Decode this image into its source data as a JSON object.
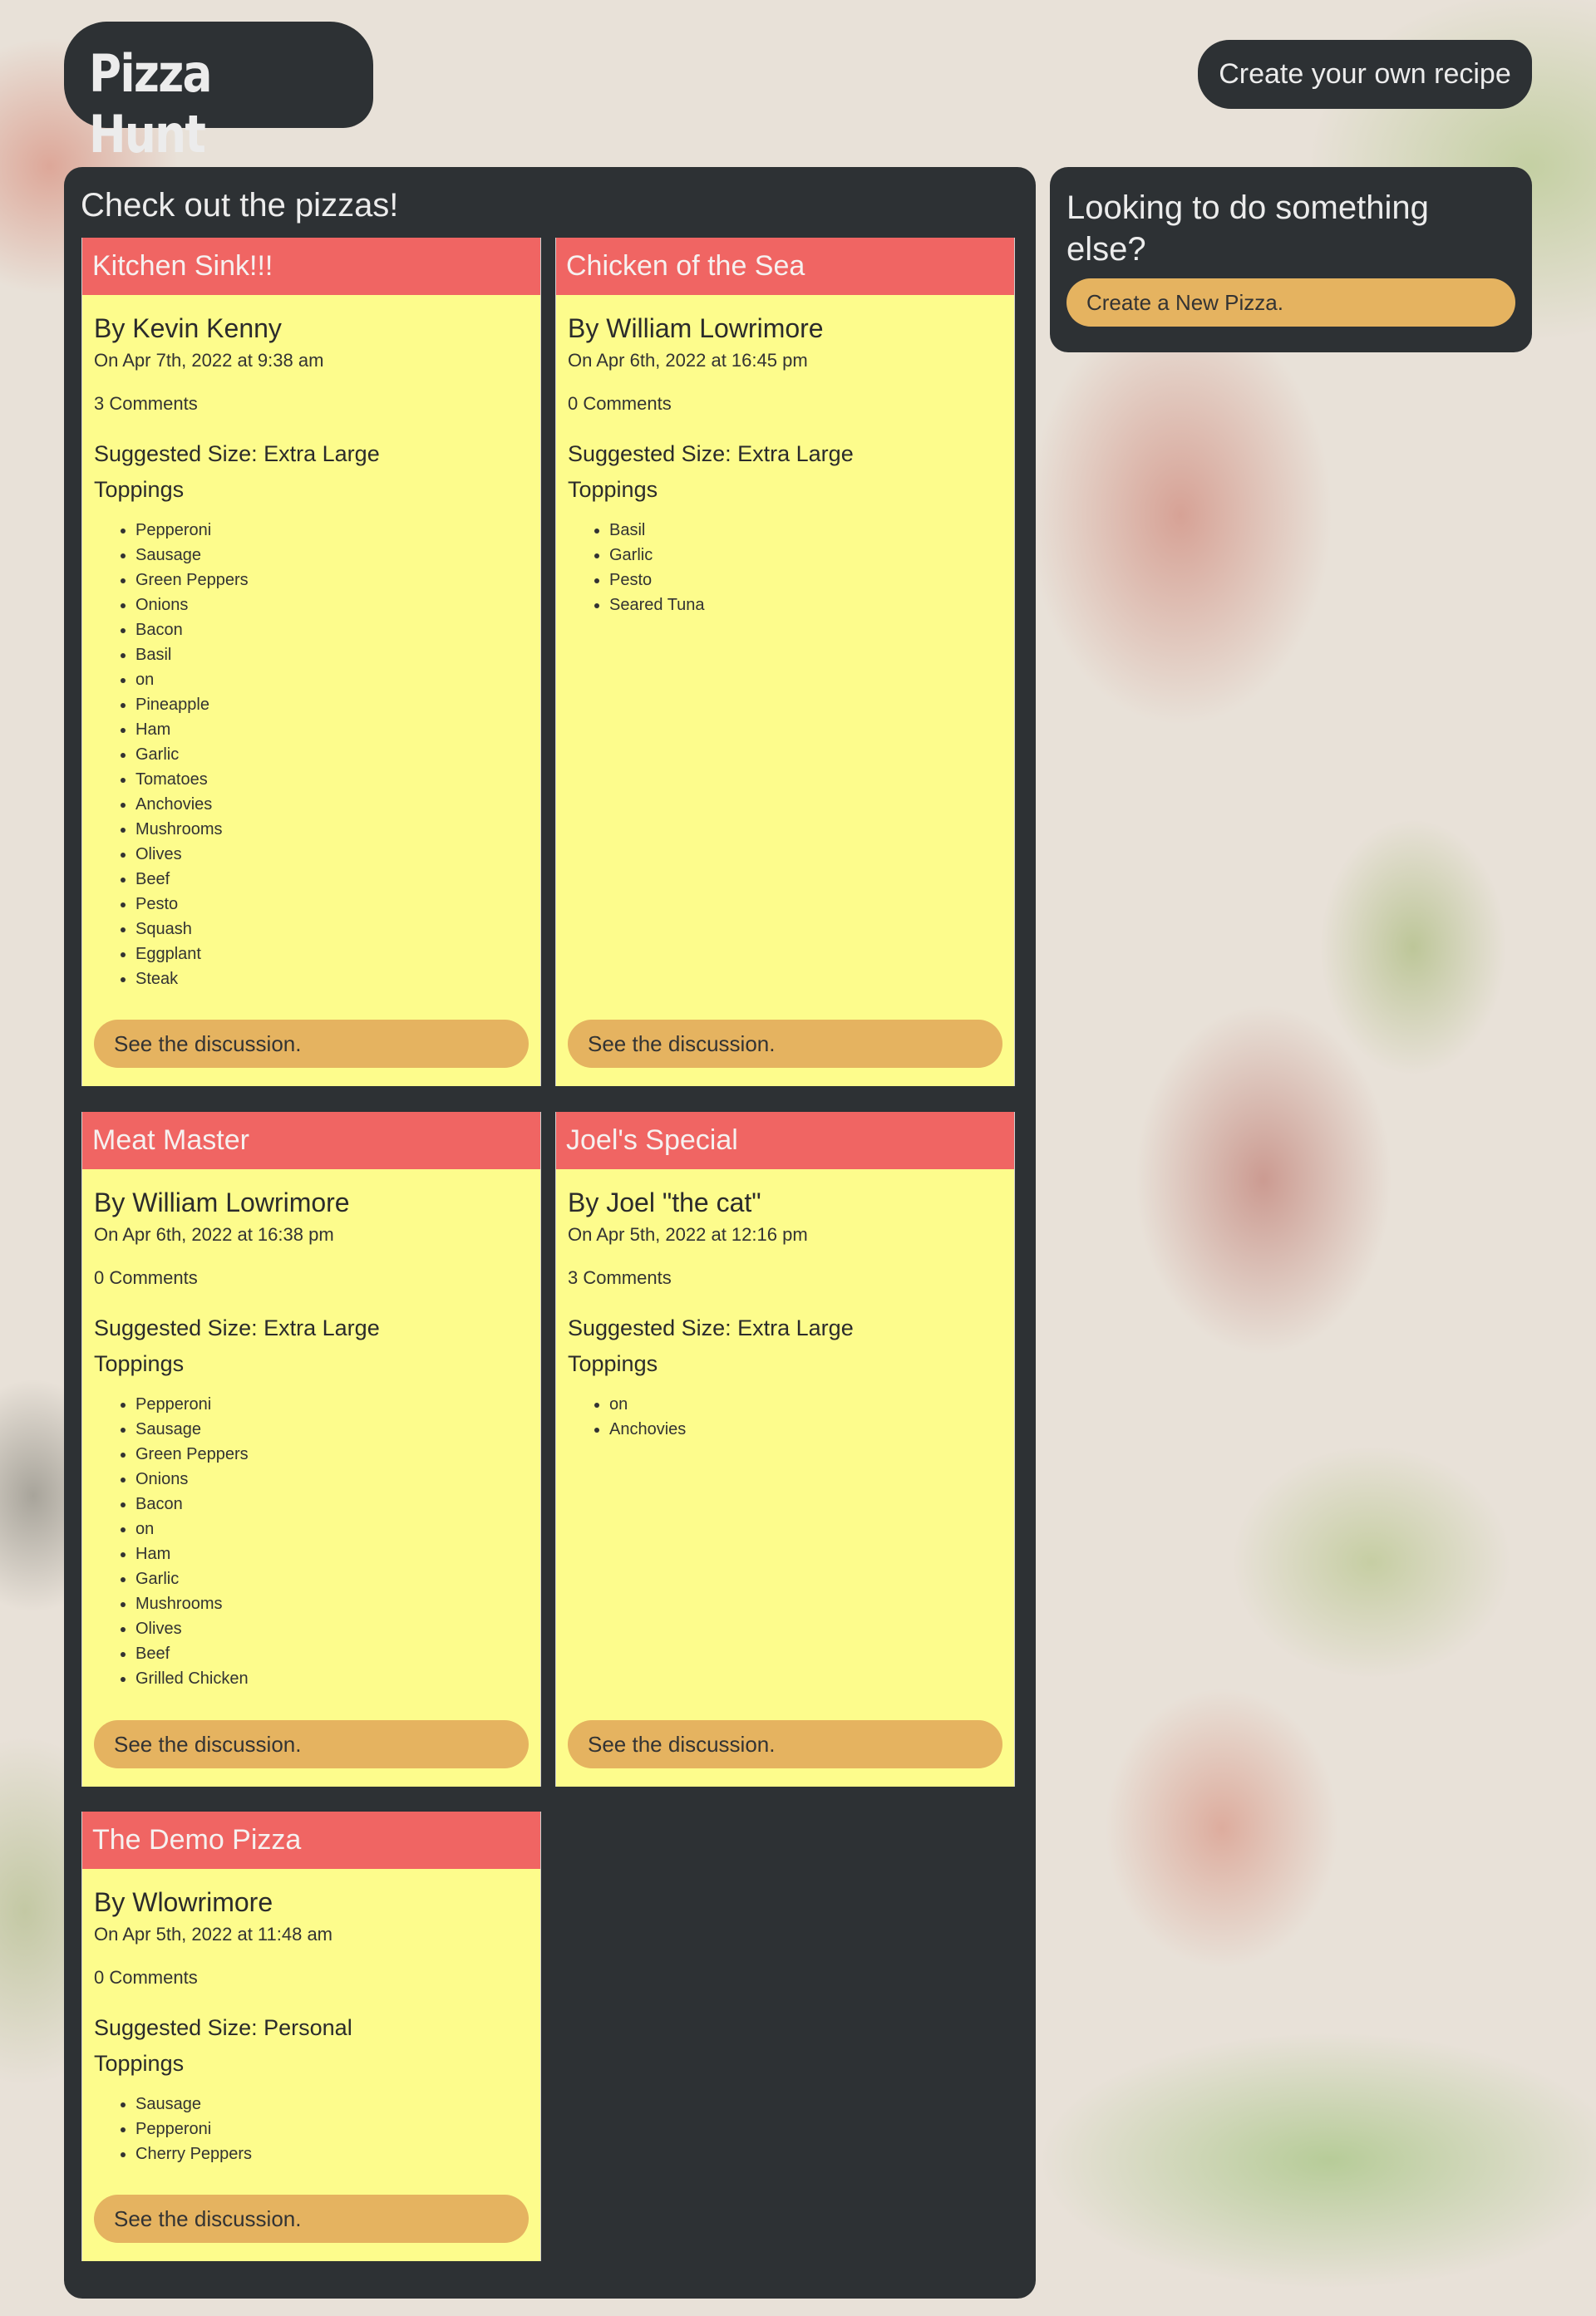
{
  "header": {
    "logo_text": "Pizza Hunt",
    "create_recipe_label": "Create your own recipe"
  },
  "main": {
    "title": "Check out the pizzas!",
    "pizzas": [
      {
        "name": "Kitchen Sink!!!",
        "author": "By Kevin Kenny",
        "date": "On Apr 7th, 2022 at 9:38 am",
        "comments": "3 Comments",
        "size": "Suggested Size: Extra Large",
        "toppings_label": "Toppings",
        "toppings": [
          "Pepperoni",
          "Sausage",
          "Green Peppers",
          "Onions",
          "Bacon",
          "Basil",
          "on",
          "Pineapple",
          "Ham",
          "Garlic",
          "Tomatoes",
          "Anchovies",
          "Mushrooms",
          "Olives",
          "Beef",
          "Pesto",
          "Squash",
          "Eggplant",
          "Steak"
        ],
        "discussion_label": "See the discussion."
      },
      {
        "name": "Chicken of the Sea",
        "author": "By William Lowrimore",
        "date": "On Apr 6th, 2022 at 16:45 pm",
        "comments": "0 Comments",
        "size": "Suggested Size: Extra Large",
        "toppings_label": "Toppings",
        "toppings": [
          "Basil",
          "Garlic",
          "Pesto",
          "Seared Tuna"
        ],
        "discussion_label": "See the discussion."
      },
      {
        "name": "Meat Master",
        "author": "By William Lowrimore",
        "date": "On Apr 6th, 2022 at 16:38 pm",
        "comments": "0 Comments",
        "size": "Suggested Size: Extra Large",
        "toppings_label": "Toppings",
        "toppings": [
          "Pepperoni",
          "Sausage",
          "Green Peppers",
          "Onions",
          "Bacon",
          "on",
          "Ham",
          "Garlic",
          "Mushrooms",
          "Olives",
          "Beef",
          "Grilled Chicken"
        ],
        "discussion_label": "See the discussion."
      },
      {
        "name": "Joel's Special",
        "author": "By Joel \"the cat\"",
        "date": "On Apr 5th, 2022 at 12:16 pm",
        "comments": "3 Comments",
        "size": "Suggested Size: Extra Large",
        "toppings_label": "Toppings",
        "toppings": [
          "on",
          "Anchovies"
        ],
        "discussion_label": "See the discussion."
      },
      {
        "name": "The Demo Pizza",
        "author": "By Wlowrimore",
        "date": "On Apr 5th, 2022 at 11:48 am",
        "comments": "0 Comments",
        "size": "Suggested Size: Personal",
        "toppings_label": "Toppings",
        "toppings": [
          "Sausage",
          "Pepperoni",
          "Cherry Peppers"
        ],
        "discussion_label": "See the discussion."
      }
    ]
  },
  "sidebar": {
    "title": "Looking to do something else?",
    "button_label": "Create a New Pizza."
  },
  "colors": {
    "panel": "#2d3134",
    "card_header": "#f06563",
    "card_body": "#fdfc8c",
    "button": "#e5b360"
  }
}
